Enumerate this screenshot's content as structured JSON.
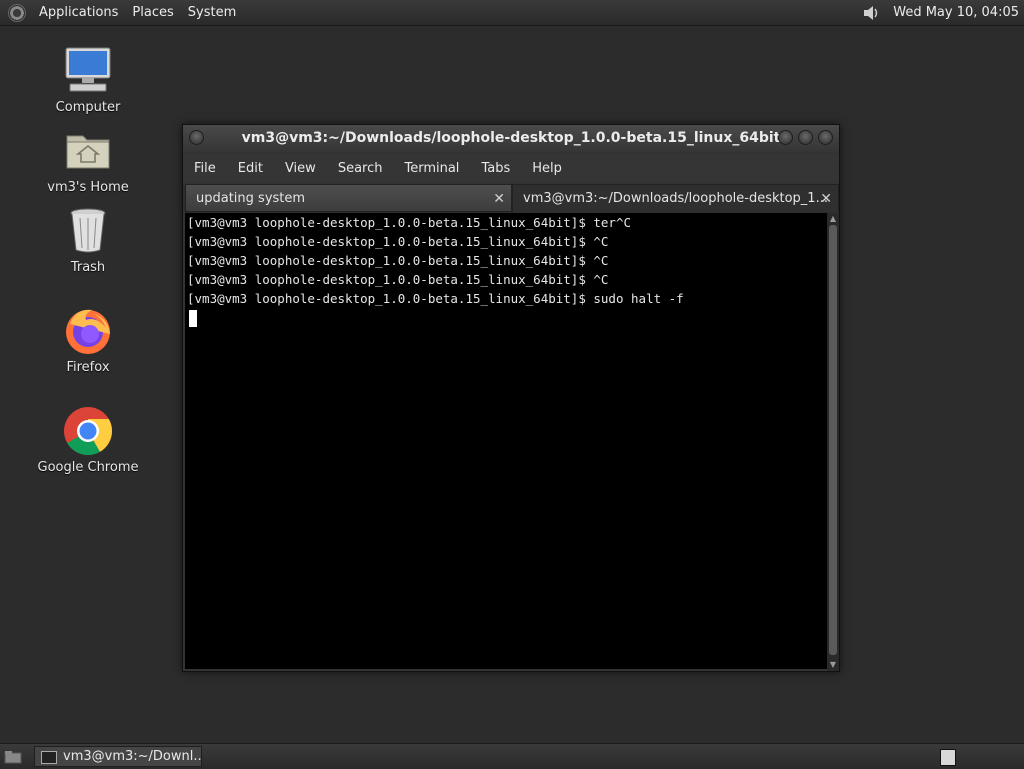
{
  "top_panel": {
    "menus": [
      "Applications",
      "Places",
      "System"
    ],
    "clock": "Wed May 10, 04:05"
  },
  "desktop": {
    "icons": [
      {
        "label": "Computer",
        "icon": "computer-icon"
      },
      {
        "label": "vm3's Home",
        "icon": "home-folder-icon"
      },
      {
        "label": "Trash",
        "icon": "trash-icon"
      },
      {
        "label": "Firefox",
        "icon": "firefox-icon"
      },
      {
        "label": "Google Chrome",
        "icon": "chrome-icon"
      }
    ]
  },
  "terminal": {
    "title": "vm3@vm3:~/Downloads/loophole-desktop_1.0.0-beta.15_linux_64bit",
    "menu": [
      "File",
      "Edit",
      "View",
      "Search",
      "Terminal",
      "Tabs",
      "Help"
    ],
    "tabs": [
      {
        "label": "updating system",
        "active": false
      },
      {
        "label": "vm3@vm3:~/Downloads/loophole-desktop_1...",
        "active": true
      }
    ],
    "lines": [
      "[vm3@vm3 loophole-desktop_1.0.0-beta.15_linux_64bit]$ ter^C",
      "[vm3@vm3 loophole-desktop_1.0.0-beta.15_linux_64bit]$ ^C",
      "[vm3@vm3 loophole-desktop_1.0.0-beta.15_linux_64bit]$ ^C",
      "[vm3@vm3 loophole-desktop_1.0.0-beta.15_linux_64bit]$ ^C",
      "[vm3@vm3 loophole-desktop_1.0.0-beta.15_linux_64bit]$ sudo halt -f"
    ]
  },
  "taskbar": {
    "task_label": "vm3@vm3:~/Downl..."
  },
  "colors": {
    "desktop_bg": "#2c2c2c",
    "terminal_bg": "#000000",
    "terminal_fg": "#e6e6e6"
  }
}
